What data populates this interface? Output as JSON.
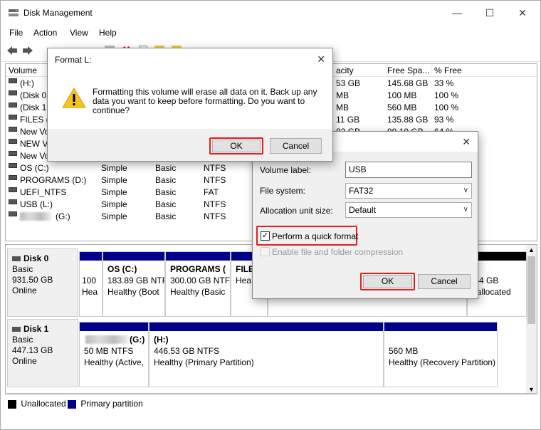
{
  "app": {
    "title": "Disk Management"
  },
  "menu": [
    "File",
    "Action",
    "View",
    "Help"
  ],
  "columns": {
    "volume": "Volume",
    "capacity": "acity",
    "free_space": "Free Spa...",
    "pct_free": "% Free"
  },
  "volumes": [
    {
      "name": "(H:)",
      "layout": "",
      "type": "",
      "fs": "",
      "capacity": "53 GB",
      "free": "145.68 GB",
      "pct": "33 %"
    },
    {
      "name": "(Disk 0 p",
      "layout": "",
      "type": "",
      "fs": "",
      "capacity": "MB",
      "free": "100 MB",
      "pct": "100 %"
    },
    {
      "name": "(Disk 1 p",
      "layout": "",
      "type": "",
      "fs": "",
      "capacity": "MB",
      "free": "560 MB",
      "pct": "100 %"
    },
    {
      "name": "FILES (E",
      "layout": "",
      "type": "",
      "fs": "",
      "capacity": "11 GB",
      "free": "135.88 GB",
      "pct": "93 %"
    },
    {
      "name": "New Vo",
      "layout": "",
      "type": "",
      "fs": "",
      "capacity": "83 GB",
      "free": "99.10 GB",
      "pct": "64 %"
    },
    {
      "name": "NEW VO",
      "layout": "",
      "type": "",
      "fs": "",
      "capacity": "",
      "free": "",
      "pct": ""
    },
    {
      "name": "New Vo",
      "layout": "",
      "type": "",
      "fs": "",
      "capacity": "",
      "free": "",
      "pct": ""
    },
    {
      "name": "OS (C:)",
      "layout": "Simple",
      "type": "Basic",
      "fs": "NTFS",
      "capacity": "",
      "free": "",
      "pct": ""
    },
    {
      "name": "PROGRAMS (D:)",
      "layout": "Simple",
      "type": "Basic",
      "fs": "NTFS",
      "capacity": "",
      "free": "",
      "pct": ""
    },
    {
      "name": "UEFI_NTFS",
      "layout": "Simple",
      "type": "Basic",
      "fs": "FAT",
      "capacity": "",
      "free": "",
      "pct": ""
    },
    {
      "name": "USB (L:)",
      "layout": "Simple",
      "type": "Basic",
      "fs": "NTFS",
      "capacity": "",
      "free": "",
      "pct": ""
    },
    {
      "name": "(G:)",
      "layout": "Simple",
      "type": "Basic",
      "fs": "NTFS",
      "capacity": "",
      "free": "",
      "pct": ""
    }
  ],
  "disk0": {
    "name": "Disk 0",
    "type": "Basic",
    "size": "931.50 GB",
    "status": "Online",
    "partitions": [
      {
        "l1": "100",
        "l2": "Hea"
      },
      {
        "title": "OS  (C:)",
        "l1": "183.89 GB NTFS",
        "l2": "Healthy (Boot"
      },
      {
        "title": "PROGRAMS  (",
        "l1": "300.00 GB NTFS",
        "l2": "Healthy (Basic"
      },
      {
        "title": "FILE",
        "l1": "",
        "l2": "Hea"
      },
      {
        "l1": ".54 GB",
        "l2": "nallocated"
      }
    ]
  },
  "disk1": {
    "name": "Disk 1",
    "type": "Basic",
    "size": "447.13 GB",
    "status": "Online",
    "partitions": [
      {
        "title": "(G:)",
        "l1": "50 MB NTFS",
        "l2": "Healthy (Active,"
      },
      {
        "title": "(H:)",
        "l1": "446.53 GB NTFS",
        "l2": "Healthy (Primary Partition)"
      },
      {
        "title": "",
        "l1": "560 MB",
        "l2": "Healthy (Recovery Partition)"
      }
    ]
  },
  "legend": {
    "unallocated": "Unallocated",
    "primary": "Primary partition"
  },
  "confirm": {
    "title": "Format L:",
    "message": "Formatting this volume will erase all data on it. Back up any data you want to keep before formatting. Do you want to continue?",
    "ok": "OK",
    "cancel": "Cancel"
  },
  "format": {
    "volume_label_label": "Volume label:",
    "volume_label_value": "USB",
    "fs_label": "File system:",
    "fs_value": "FAT32",
    "alloc_label": "Allocation unit size:",
    "alloc_value": "Default",
    "quick_format": "Perform a quick format",
    "quick_format_checked": true,
    "compression": "Enable file and folder compression",
    "ok": "OK",
    "cancel": "Cancel"
  },
  "colors": {
    "primary_partition": "#00008b",
    "unallocated": "#000000",
    "highlight": "#e02020"
  }
}
